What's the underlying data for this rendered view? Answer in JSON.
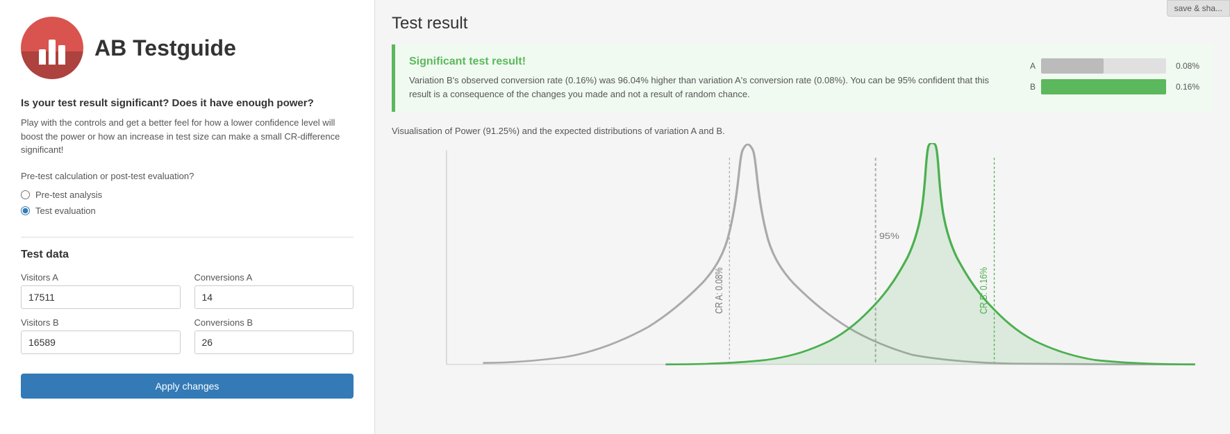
{
  "logo": {
    "text_ab": "AB",
    "text_testguide": "Testguide"
  },
  "left": {
    "headline": "Is your test result significant? Does it have enough power?",
    "description": "Play with the controls and get a better feel for how a lower confidence level will boost the power or how an increase in test size can make a small CR-difference significant!",
    "analysis_label": "Pre-test calculation or post-test evaluation?",
    "radio_options": [
      {
        "id": "pre-test",
        "label": "Pre-test analysis",
        "checked": false
      },
      {
        "id": "test-eval",
        "label": "Test evaluation",
        "checked": true
      }
    ],
    "test_data_title": "Test data",
    "fields": [
      {
        "id": "visitors-a",
        "label": "Visitors A",
        "value": "17511"
      },
      {
        "id": "conversions-a",
        "label": "Conversions A",
        "value": "14"
      },
      {
        "id": "visitors-b",
        "label": "Visitors B",
        "value": "16589"
      },
      {
        "id": "conversions-b",
        "label": "Conversions B",
        "value": "26"
      }
    ],
    "apply_button": "Apply changes"
  },
  "right": {
    "save_share_button": "save & sha...",
    "result_title": "Test result",
    "significant_title": "Significant test result!",
    "result_description": "Variation B's observed conversion rate (0.16%) was 96.04% higher than variation A's conversion rate (0.08%). You can be 95% confident that this result is a consequence of the changes you made and not a result of random chance.",
    "bars": [
      {
        "label": "A",
        "value": "0.08%",
        "pct": 50,
        "color": "gray"
      },
      {
        "label": "B",
        "value": "0.16%",
        "pct": 100,
        "color": "green"
      }
    ],
    "power_label": "Visualisation of Power (91.25%) and the expected distributions of variation A and B.",
    "cr_a": "CR A: 0.08%",
    "cr_b": "CR B: 0.16%",
    "confidence": "95%"
  }
}
